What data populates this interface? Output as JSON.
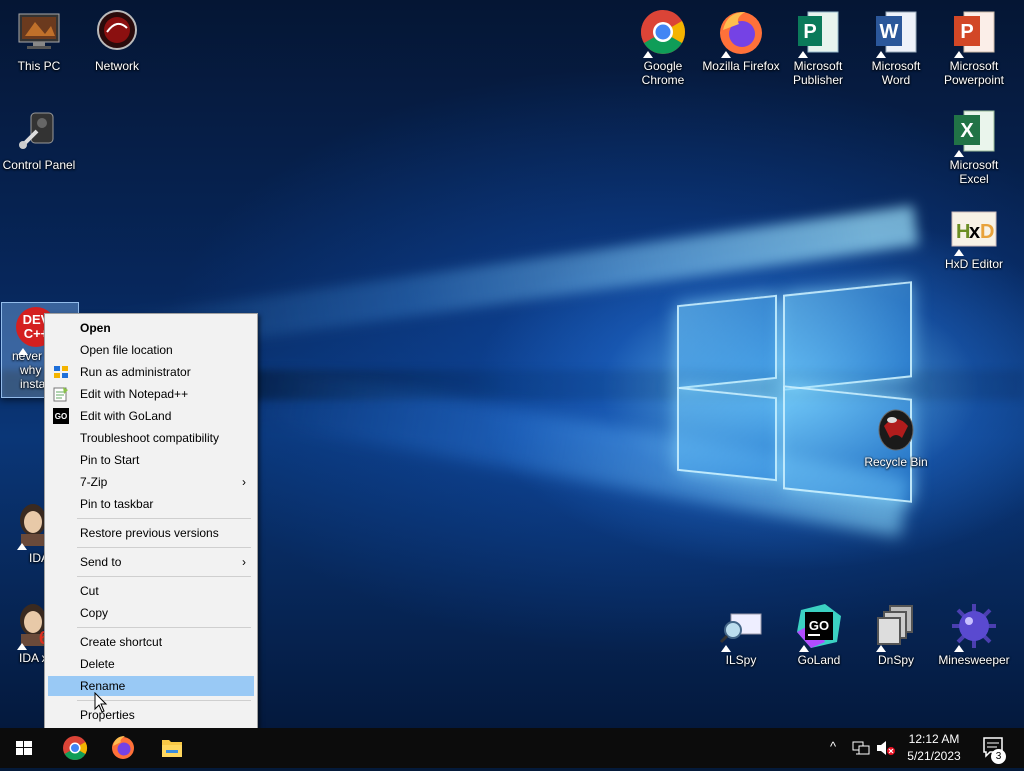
{
  "desktop_icons": {
    "this_pc": "This PC",
    "network": "Network",
    "control_panel": "Control Panel",
    "dev_cpp_line1": "never",
    "dev_cpp_line2": "why",
    "dev_cpp_line3": "insta",
    "dev_cpp_badge": "DEV\nC++",
    "ida": "IDA",
    "ida64": "IDA x",
    "chrome": "Google Chrome",
    "firefox": "Mozilla Firefox",
    "publisher": "Microsoft Publisher",
    "word": "Microsoft Word",
    "powerpoint": "Microsoft Powerpoint",
    "excel": "Microsoft Excel",
    "hxd": "HxD Editor",
    "recycle_bin": "Recycle Bin",
    "ilspy": "ILSpy",
    "goland": "GoLand",
    "dnspy": "DnSpy",
    "minesweeper": "Minesweeper"
  },
  "context_menu": {
    "open": "Open",
    "open_file_location": "Open file location",
    "run_as_admin": "Run as administrator",
    "edit_notepadpp": "Edit with Notepad++",
    "edit_goland": "Edit with GoLand",
    "troubleshoot": "Troubleshoot compatibility",
    "pin_start": "Pin to Start",
    "seven_zip": "7-Zip",
    "pin_taskbar": "Pin to taskbar",
    "restore_versions": "Restore previous versions",
    "send_to": "Send to",
    "cut": "Cut",
    "copy": "Copy",
    "create_shortcut": "Create shortcut",
    "delete": "Delete",
    "rename": "Rename",
    "properties": "Properties",
    "submenu_glyph": "›"
  },
  "taskbar": {
    "time": "12:12 AM",
    "date": "5/21/2023",
    "notification_count": "3",
    "chevron": "^"
  },
  "colors": {
    "menu_highlight": "#99c9f5",
    "taskbar_bg": "#0c0c0c"
  }
}
